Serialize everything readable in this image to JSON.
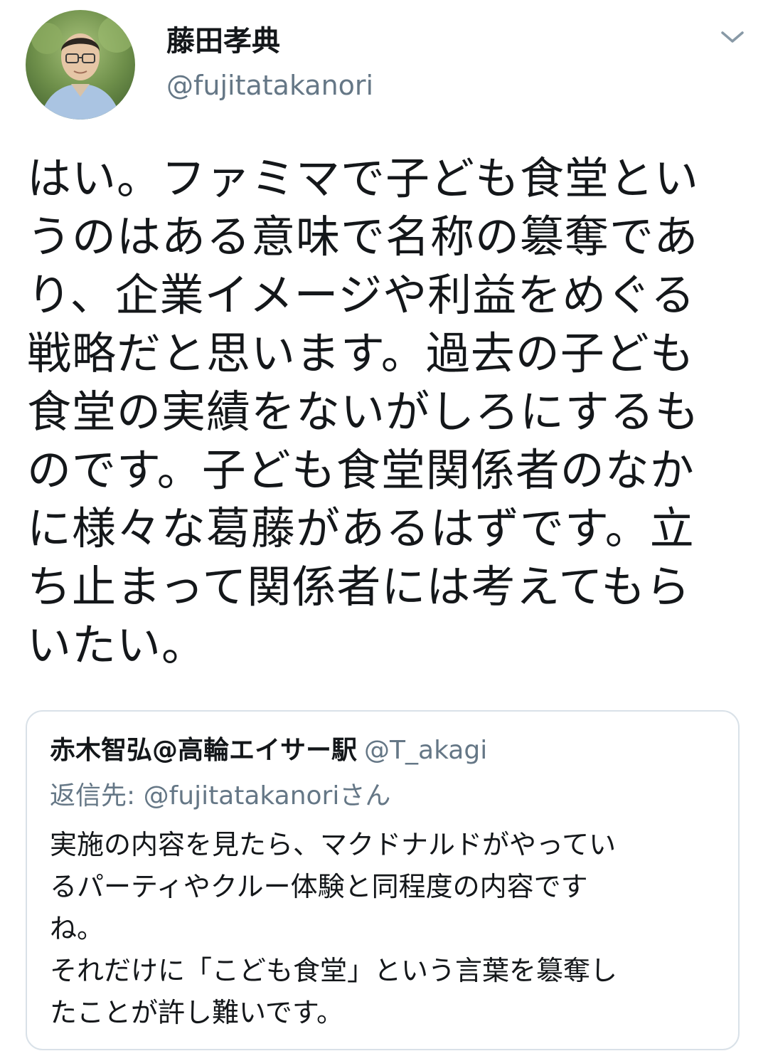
{
  "tweet": {
    "author": {
      "display_name": "藤田孝典",
      "handle": "@fujitatakanori",
      "avatar_icon": "user-avatar-photo"
    },
    "menu_icon": "chevron-down-icon",
    "text_lines": [
      "はい。ファミマで子ども食堂とい",
      "うのはある意味で名称の簒奪であ",
      "り、企業イメージや利益をめぐる",
      "戦略だと思います。過去の子ども",
      "食堂の実績をないがしろにするも",
      "のです。子ども食堂関係者のなか",
      "に様々な葛藤があるはずです。立",
      "ち止まって関係者には考えてもら",
      "いたい。"
    ]
  },
  "quoted_tweet": {
    "display_name": "赤木智弘@高輪エイサー駅",
    "handle": "@T_akagi",
    "reply_to": "返信先: @fujitatakanoriさん",
    "body_lines": [
      "実施の内容を見たら、マクドナルドがやってい",
      "るパーティやクルー体験と同程度の内容です",
      "ね。",
      "それだけに「こども食堂」という言葉を簒奪し",
      "たことが許し難いです。"
    ]
  },
  "colors": {
    "text_primary": "#14171a",
    "text_secondary": "#657786",
    "card_border": "#d9e1e8"
  }
}
